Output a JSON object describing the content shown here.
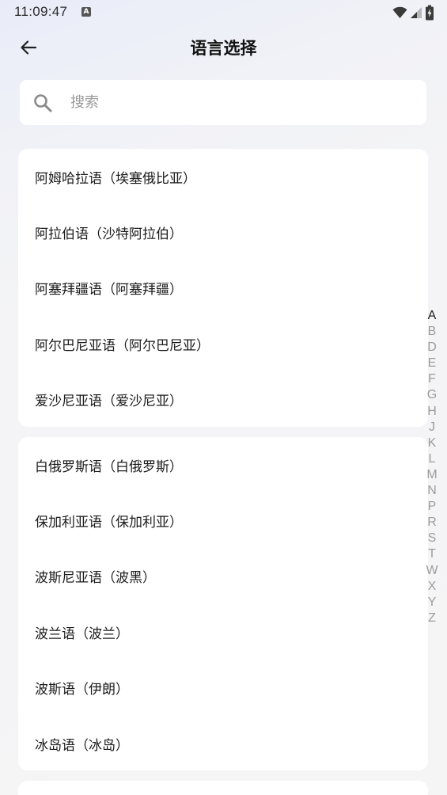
{
  "status_bar": {
    "time": "11:09:47",
    "notification_icon": "A"
  },
  "header": {
    "title": "语言选择"
  },
  "search": {
    "placeholder": "搜索",
    "value": ""
  },
  "groups": [
    {
      "letter": "A",
      "items": [
        "阿姆哈拉语（埃塞俄比亚）",
        "阿拉伯语（沙特阿拉伯）",
        "阿塞拜疆语（阿塞拜疆）",
        "阿尔巴尼亚语（阿尔巴尼亚）",
        "爱沙尼亚语（爱沙尼亚）"
      ]
    },
    {
      "letter": "B",
      "items": [
        "白俄罗斯语（白俄罗斯）",
        "保加利亚语（保加利亚）",
        "波斯尼亚语（波黑）",
        "波兰语（波兰）",
        "波斯语（伊朗）",
        "冰岛语（冰岛）"
      ]
    }
  ],
  "index_bar": {
    "letters": [
      "A",
      "B",
      "D",
      "E",
      "F",
      "G",
      "H",
      "J",
      "K",
      "L",
      "M",
      "N",
      "P",
      "R",
      "S",
      "T",
      "W",
      "X",
      "Y",
      "Z"
    ],
    "active": "A"
  }
}
